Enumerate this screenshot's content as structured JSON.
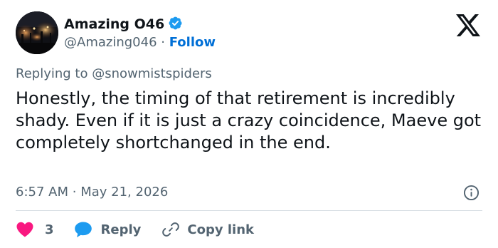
{
  "author": {
    "display_name": "Amazing O46",
    "handle": "@Amazing046",
    "separator": "·",
    "follow_label": "Follow",
    "avatar_icon": "night-scene-avatar",
    "verified_icon": "verified-badge-icon"
  },
  "reply_to": {
    "prefix": "Replying to",
    "handle": "@snowmistspiders"
  },
  "tweet": {
    "text": "Honestly, the timing of that retirement is incredibly shady. Even if it is just a crazy coincidence, Maeve got completely shortchanged in the end.",
    "time": "6:57 AM",
    "separator": "·",
    "date": "May 21, 2026"
  },
  "actions": {
    "like_count": "3",
    "reply_label": "Reply",
    "copy_label": "Copy link"
  },
  "icons": {
    "logo": "x-logo-icon",
    "info": "info-icon",
    "like": "heart-icon",
    "reply": "speech-bubble-icon",
    "copy": "link-icon"
  },
  "colors": {
    "text": "#0f1419",
    "secondary": "#536471",
    "accent_blue": "#006fd6",
    "verified_blue": "#1d9bf0",
    "heart": "#f91880",
    "divider": "#d6dde3"
  }
}
